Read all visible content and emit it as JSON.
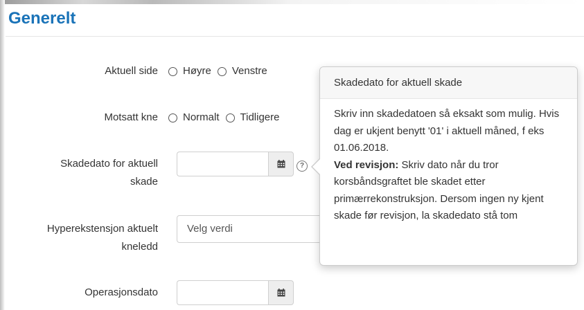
{
  "section": {
    "title": "Generelt"
  },
  "fields": {
    "aktuell_side": {
      "label": "Aktuell side",
      "options": [
        "Høyre",
        "Venstre"
      ]
    },
    "motsatt_kne": {
      "label": "Motsatt kne",
      "options": [
        "Normalt",
        "Tidligere"
      ]
    },
    "skadedato": {
      "label_line1": "Skadedato for aktuell",
      "label_line2": "skade",
      "value": "",
      "help": "?"
    },
    "hyperekstensjon": {
      "label_line1": "Hyperekstensjon aktuelt",
      "label_line2": "kneledd",
      "value": "Velg verdi"
    },
    "operasjonsdato": {
      "label": "Operasjonsdato",
      "value": ""
    }
  },
  "icons": {
    "calendar": "calendar-icon",
    "help": "question-circle-icon",
    "radio": "radio-circle"
  },
  "popover": {
    "title": "Skadedato for aktuell skade",
    "para1": "Skriv inn skadedatoen så eksakt som mulig. Hvis dag er ukjent benytt '01' i aktuell måned, f eks 01.06.2018.",
    "bold_label": "Ved revisjon:",
    "para2": " Skriv dato når du tror korsbåndsgraftet ble skadet etter primærrekonstruksjon. Dersom ingen ny kjent skade før revisjon, la skadedato stå tom"
  },
  "colors": {
    "title": "#1a73b8",
    "addon_bg": "#eeeeee",
    "popover_header_bg": "#f7f7f7"
  }
}
